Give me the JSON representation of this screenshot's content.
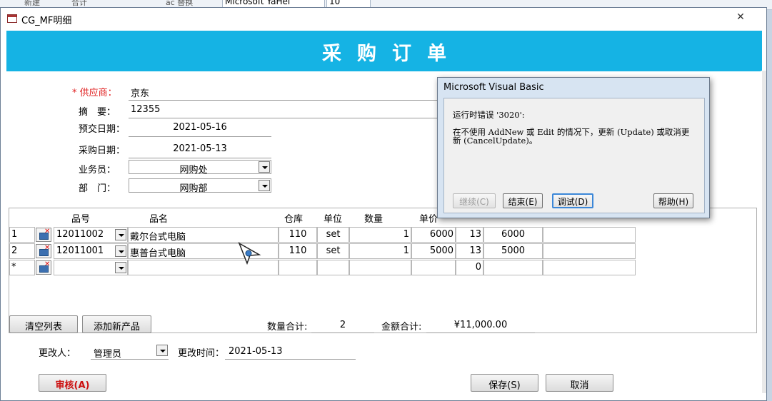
{
  "ribbon": {
    "items": [
      "新建",
      "合计",
      "ac 替换"
    ],
    "font_name": "Microsoft YaHei",
    "font_size": "10"
  },
  "window": {
    "title": "CG_MF明细",
    "close_glyph": "✕"
  },
  "header": {
    "title": "采购订单"
  },
  "form": {
    "supplier_label": "* 供应商：",
    "supplier_value": "京东",
    "summary_label": "摘　要：",
    "summary_value": "12355",
    "pre_date_label": "预交日期：",
    "pre_date_value": "2021-05-16",
    "purchase_date_label": "采购日期：",
    "purchase_date_value": "2021-05-13",
    "salesman_label": "业务员：",
    "salesman_value": "网购处",
    "dept_label": "部　门：",
    "dept_value": "网购部"
  },
  "grid": {
    "headers": [
      "品号",
      "品名",
      "仓库",
      "单位",
      "数量",
      "单价"
    ],
    "rows": [
      {
        "selector": "1",
        "code": "12011002",
        "name": "戴尔台式电脑",
        "warehouse": "110",
        "unit": "set",
        "qty": "1",
        "price": "6000",
        "tax": "13",
        "amount": "6000"
      },
      {
        "selector": "2",
        "code": "12011001",
        "name": "惠普台式电脑",
        "warehouse": "110",
        "unit": "set",
        "qty": "1",
        "price": "5000",
        "tax": "13",
        "amount": "5000"
      },
      {
        "selector": "*",
        "code": "",
        "name": "",
        "warehouse": "",
        "unit": "",
        "qty": "",
        "price": "",
        "tax": "0",
        "amount": ""
      }
    ]
  },
  "footer": {
    "clear_button": "清空列表",
    "add_product_button": "添加新产品",
    "qty_total_label": "数量合计:",
    "qty_total_value": "2",
    "amount_total_label": "金额合计:",
    "amount_total_value": "¥11,000.00",
    "modifier_label": "更改人：",
    "modifier_value": "管理员",
    "modify_time_label": "更改时间：",
    "modify_time_value": "2021-05-13",
    "approve_button": "审核(A)",
    "save_button": "保存(S)",
    "cancel_button": "取消"
  },
  "dialog": {
    "title": "Microsoft Visual Basic",
    "error_line": "运行时错误 '3020':",
    "message_line1": "在不使用 AddNew 或 Edit 的情况下，更新 (Update) 或取消更",
    "message_line2": "新 (CancelUpdate)。",
    "continue_button": "继续(C)",
    "end_button": "结束(E)",
    "debug_button": "调试(D)",
    "help_button": "帮助(H)"
  },
  "colors": {
    "header_bg": "#15b3e4",
    "required_red": "#e02020",
    "approve_red": "#cc1111"
  }
}
